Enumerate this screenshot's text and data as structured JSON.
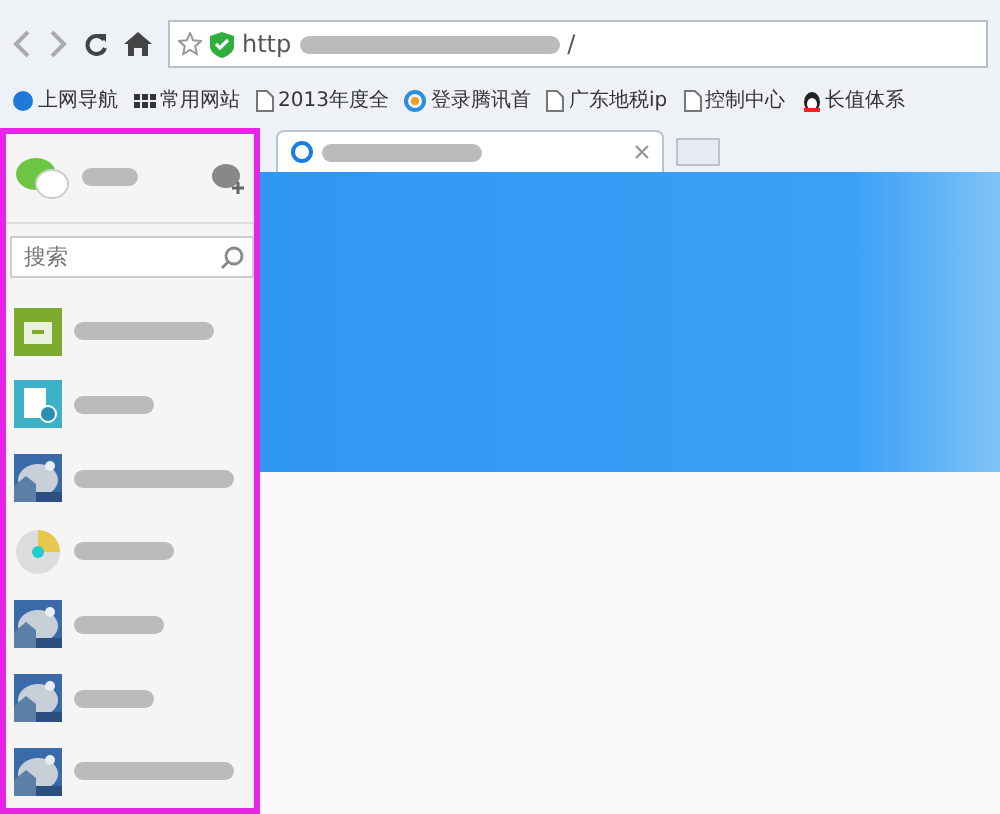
{
  "toolbar": {
    "url": "http",
    "url_end": "/"
  },
  "bookmarks": [
    {
      "kind": "ie",
      "label": "上网导航"
    },
    {
      "kind": "grid",
      "label": "常用网站"
    },
    {
      "kind": "page",
      "label": "2013年度全"
    },
    {
      "kind": "tencent",
      "label": "登录腾讯首"
    },
    {
      "kind": "page",
      "label": "广东地税ip"
    },
    {
      "kind": "page",
      "label": "控制中心"
    },
    {
      "kind": "penguin",
      "label": "长值体系"
    }
  ],
  "sidebar": {
    "search": {
      "placeholder": "搜索"
    },
    "contacts": [
      {
        "kind": "folder"
      },
      {
        "kind": "document"
      },
      {
        "kind": "picture"
      },
      {
        "kind": "disc"
      },
      {
        "kind": "picture"
      },
      {
        "kind": "picture"
      },
      {
        "kind": "picture"
      }
    ]
  },
  "tab": {
    "selected": true
  }
}
